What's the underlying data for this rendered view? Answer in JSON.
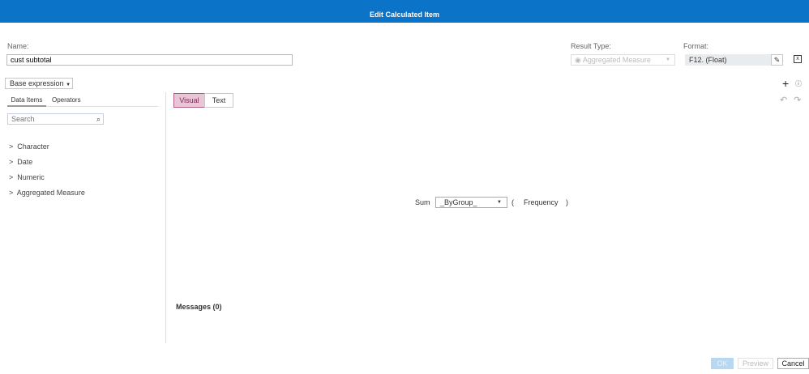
{
  "title": "Edit Calculated Item",
  "name": {
    "label": "Name:",
    "value": "cust subtotal"
  },
  "result_type": {
    "label": "Result Type:",
    "value": "Aggregated Measure"
  },
  "format": {
    "label": "Format:",
    "value": "F12. (Float)"
  },
  "base_expression": "Base expression",
  "tabs": {
    "data_items": "Data Items",
    "operators": "Operators"
  },
  "search": {
    "placeholder": "Search"
  },
  "tree": [
    "Character",
    "Date",
    "Numeric",
    "Aggregated Measure"
  ],
  "mode": {
    "visual": "Visual",
    "text": "Text"
  },
  "expr": {
    "func": "Sum",
    "group": "_ByGroup_",
    "open": "(",
    "arg": "Frequency",
    "close": ")"
  },
  "messages": "Messages (0)",
  "footer": {
    "ok": "OK",
    "preview": "Preview",
    "cancel": "Cancel"
  },
  "colors": {
    "header": "#0b74c9",
    "visual_active": "#e8c6d6"
  }
}
